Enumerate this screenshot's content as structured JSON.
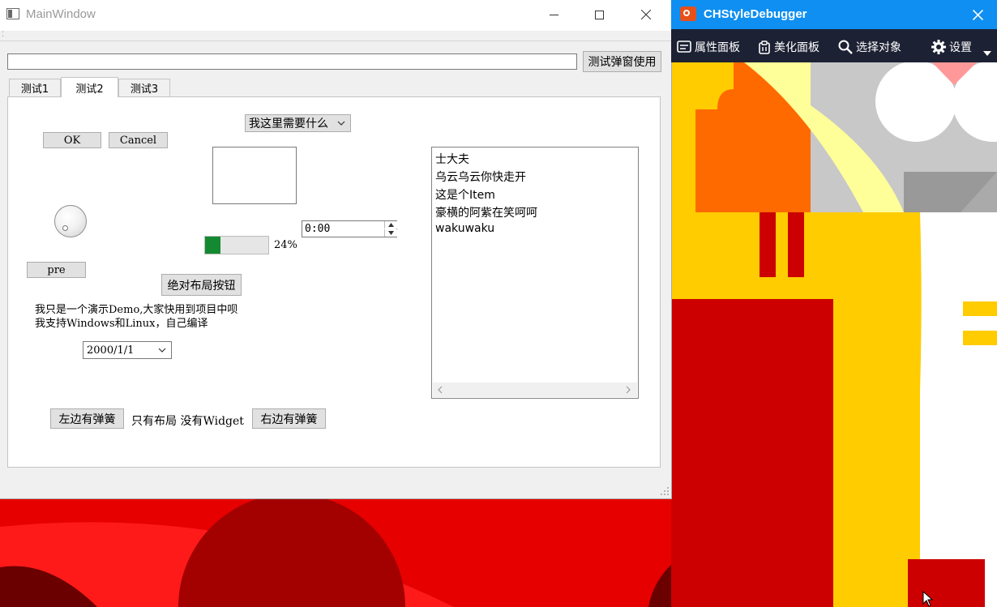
{
  "main_window": {
    "title": "MainWindow",
    "test_popup_button": "测试弹窗使用",
    "top_input_value": "",
    "tabs": [
      {
        "label": "测试1",
        "active": false
      },
      {
        "label": "测试2",
        "active": true
      },
      {
        "label": "测试3",
        "active": false
      }
    ],
    "ok_button": "OK",
    "cancel_button": "Cancel",
    "top_combo_value": "我这里需要什么",
    "progress_percent": 24,
    "progress_label": "24%",
    "time_value": "0:00",
    "pre_button": "pre",
    "absolute_layout_button": "绝对布局按钮",
    "demo_text_line1": "我只是一个演示Demo,大家快用到项目中呗",
    "demo_text_line2": "我支持Windows和Linux，自己编译",
    "date_value": "2000/1/1",
    "list_items": [
      "士大夫",
      "乌云乌云你快走开",
      "这是个Item",
      "豪横的阿紫在笑呵呵",
      "wakuwaku"
    ],
    "left_spring_button": "左边有弹簧",
    "only_layout_label": "只有布局 没有Widget",
    "right_spring_button": "右边有弹簧"
  },
  "debugger": {
    "title": "CHStyleDebugger",
    "toolbar": [
      {
        "label": "属性面板",
        "icon": "property-panel-icon"
      },
      {
        "label": "美化面板",
        "icon": "clipboard-icon"
      },
      {
        "label": "选择对象",
        "icon": "search-icon"
      },
      {
        "label": "设置",
        "icon": "gear-icon"
      }
    ],
    "colors": {
      "title_bar": "#0e8ff1",
      "toolbar": "#1c2133",
      "logo": "#e8501a"
    }
  },
  "colors": {
    "progress_fill": "#138a31",
    "background_yellow": "#ffcc00",
    "background_red": "#cc0000",
    "background_orange": "#ff6a00"
  }
}
